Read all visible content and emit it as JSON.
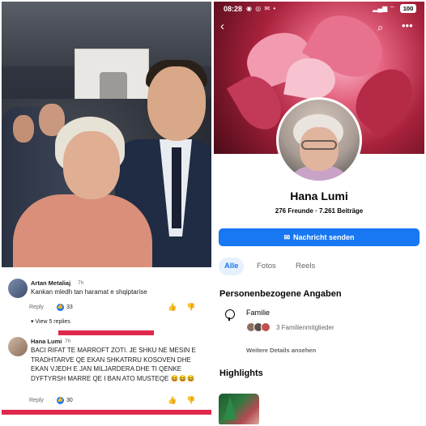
{
  "comments": {
    "c1": {
      "author": "Artan Metaliaj",
      "time": "7h",
      "text": "Kankan mledh tan haramat e shqiptarise",
      "reply": "Reply",
      "likes": "33",
      "view_replies": "View 5 replies"
    },
    "c2": {
      "author": "Hana Lumi",
      "time": "7h",
      "text": "BACI  RIFAT  TE MARROFT ZOTI.  JE SHKU  NE MESIN E   TRADHTARVE   QE EKAN  SHKATRRU KOSOVEN   DHE EKAN VJEDH E JAN  MILJARDERA DHE TI QENKE  DYFTYRSH  MARRE  QE I BAN ATO MUSTEQE 😆😆😆",
      "reply": "Reply",
      "likes": "30"
    }
  },
  "profile": {
    "status_time": "08:28",
    "status_icons": "◉ ◎ ✉ •",
    "battery": "100",
    "name": "Hana Lumi",
    "stats": "276 Freunde · 7.261 Beiträge",
    "message_button": "Nachricht senden",
    "tabs": [
      "Alle",
      "Fotos",
      "Reels"
    ],
    "section_personal": "Personenbezogene Angaben",
    "family_label": "Familie",
    "family_members": "3 Familienmitglieder",
    "details_link": "Weitere Details ansehen",
    "section_highlights": "Highlights"
  },
  "colors": {
    "accent": "#1877f2",
    "redbar": "#e0284c"
  }
}
